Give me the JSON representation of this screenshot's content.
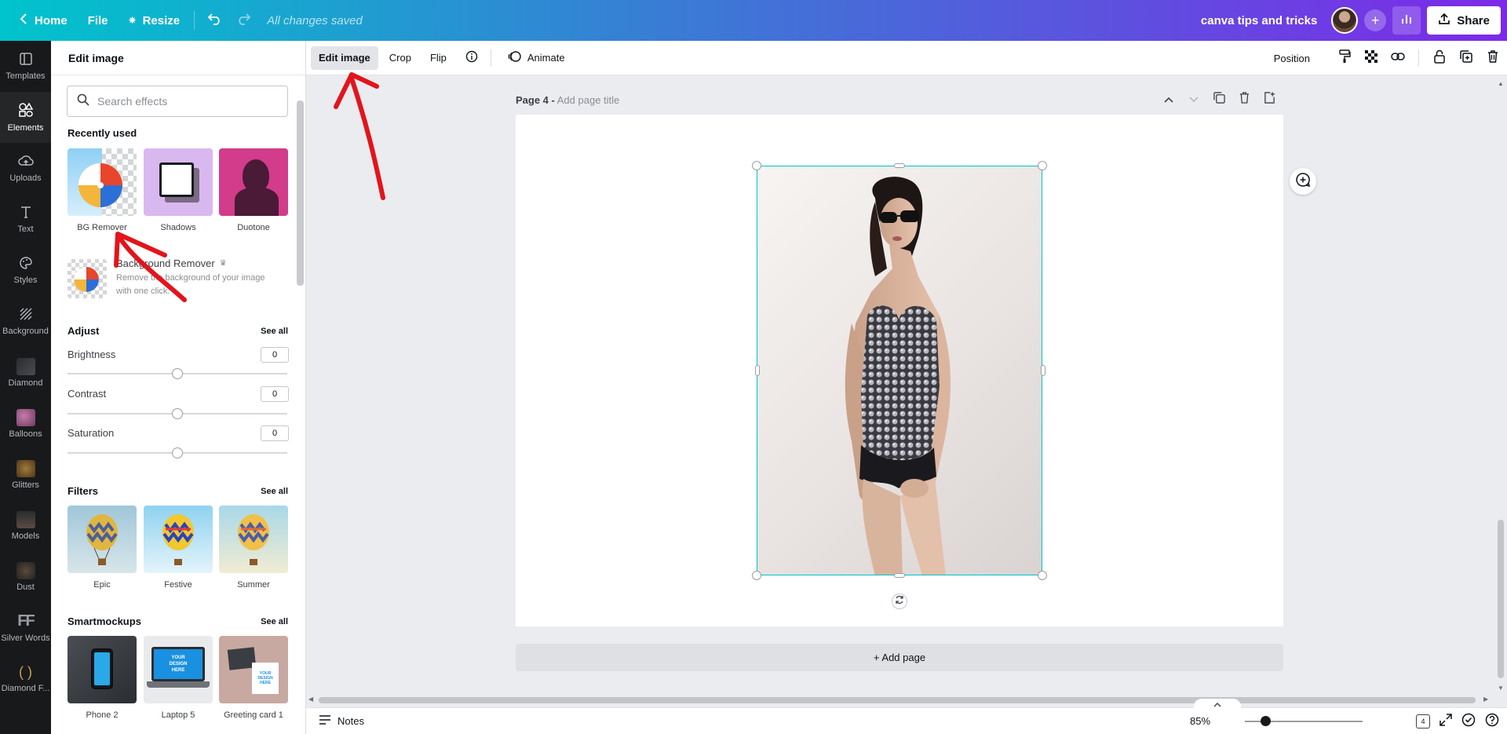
{
  "topbar": {
    "home": "Home",
    "file": "File",
    "resize": "Resize",
    "saved_status": "All changes saved",
    "design_title": "canva tips and tricks",
    "share": "Share",
    "gradient_start": "#00c4cc",
    "gradient_end": "#7d2ae8"
  },
  "rail": {
    "items": [
      {
        "label": "Templates",
        "icon": "templates-icon"
      },
      {
        "label": "Elements",
        "icon": "elements-icon"
      },
      {
        "label": "Uploads",
        "icon": "uploads-icon"
      },
      {
        "label": "Text",
        "icon": "text-icon"
      },
      {
        "label": "Styles",
        "icon": "styles-icon"
      },
      {
        "label": "Background",
        "icon": "background-icon"
      },
      {
        "label": "Diamond",
        "icon": "diamond-thumb"
      },
      {
        "label": "Balloons",
        "icon": "balloons-thumb"
      },
      {
        "label": "Glitters",
        "icon": "glitters-thumb"
      },
      {
        "label": "Models",
        "icon": "models-thumb"
      },
      {
        "label": "Dust",
        "icon": "dust-thumb"
      },
      {
        "label": "Silver Words",
        "icon": "silver-words-thumb"
      },
      {
        "label": "Diamond F...",
        "icon": "diamond-f-thumb"
      }
    ]
  },
  "panel": {
    "title": "Edit image",
    "search_placeholder": "Search effects",
    "recently_used": {
      "title": "Recently used",
      "items": [
        {
          "label": "BG Remover"
        },
        {
          "label": "Shadows"
        },
        {
          "label": "Duotone"
        }
      ]
    },
    "bg_remover_card": {
      "title": "Background Remover",
      "description": "Remove the background of your image with one click."
    },
    "adjust": {
      "title": "Adjust",
      "see_all": "See all",
      "sliders": [
        {
          "label": "Brightness",
          "value": "0"
        },
        {
          "label": "Contrast",
          "value": "0"
        },
        {
          "label": "Saturation",
          "value": "0"
        }
      ]
    },
    "filters": {
      "title": "Filters",
      "see_all": "See all",
      "items": [
        {
          "label": "Epic"
        },
        {
          "label": "Festive"
        },
        {
          "label": "Summer"
        }
      ]
    },
    "smartmockups": {
      "title": "Smartmockups",
      "see_all": "See all",
      "items": [
        {
          "label": "Phone 2"
        },
        {
          "label": "Laptop 5",
          "screen_text": "YOUR DESIGN HERE"
        },
        {
          "label": "Greeting card 1",
          "screen_text": "YOUR DESIGN HERE"
        }
      ]
    }
  },
  "context_toolbar": {
    "edit_image": "Edit image",
    "crop": "Crop",
    "flip": "Flip",
    "animate": "Animate",
    "position": "Position"
  },
  "canvas": {
    "page_label": "Page 4 -",
    "page_title_placeholder": "Add page title",
    "add_page": "+ Add page",
    "selection_color": "#00c4cc"
  },
  "bottombar": {
    "notes": "Notes",
    "zoom": "85%",
    "page_count": "4"
  },
  "annotation_color": "#e3141b"
}
